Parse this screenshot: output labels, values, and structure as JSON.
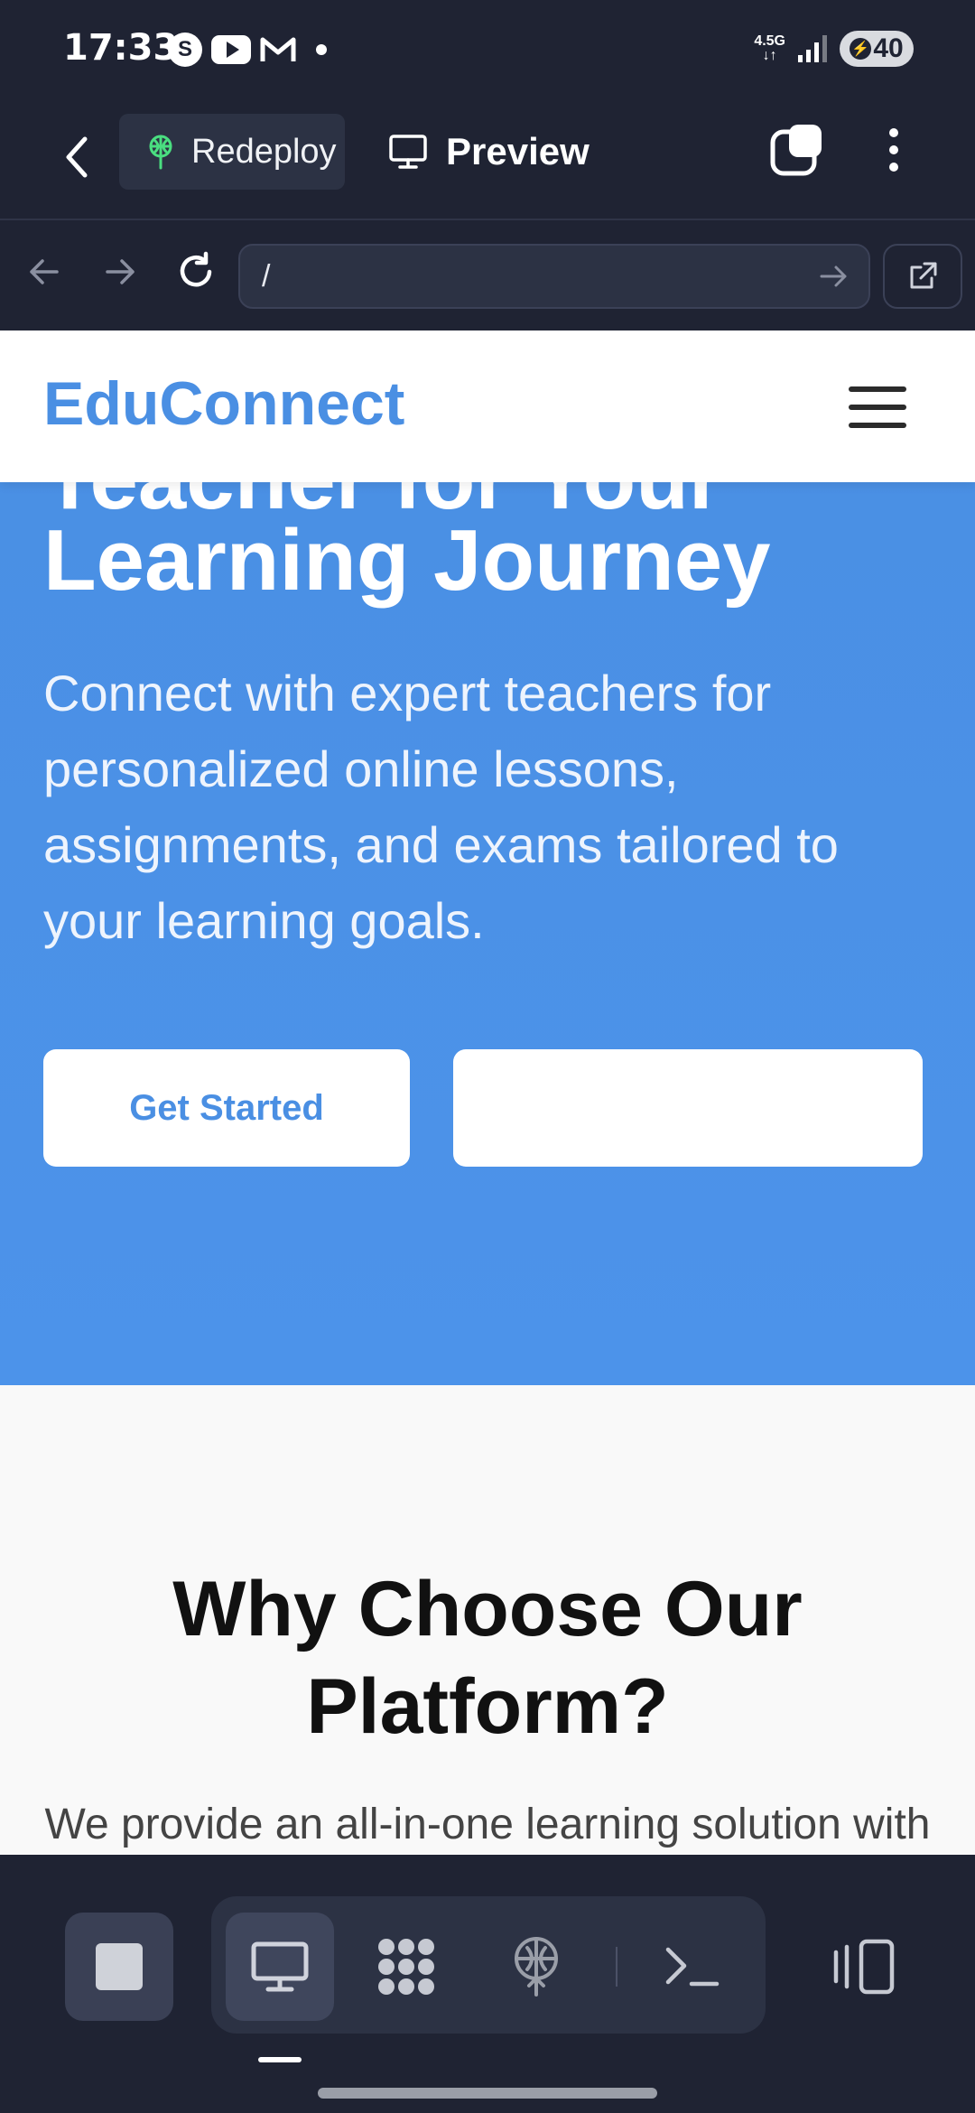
{
  "status_bar": {
    "time": "17:33",
    "network": "4.5G",
    "battery": "40",
    "notification_icons": [
      "s-app-icon",
      "youtube-icon",
      "gmail-icon"
    ]
  },
  "toolbar": {
    "redeploy_label": "Redeploy",
    "preview_label": "Preview"
  },
  "browser": {
    "url": "/"
  },
  "site": {
    "logo": "EduConnect",
    "hero_clipped_line": "Teacher for Your",
    "hero_title": "Learning Journey",
    "hero_subtitle": "Connect with expert teachers for personalized online lessons, assignments, and exams tailored to your learning goals.",
    "primary_button": "Get Started",
    "secondary_button": "",
    "section_title": "Why Choose Our Platform?",
    "section_subtitle": "We provide an all-in-one learning solution with"
  },
  "colors": {
    "app_background": "#1f2333",
    "brand_blue": "#4a8fe3",
    "hero_background": "#4c93ea",
    "redeploy_accent": "#4ade80"
  },
  "dock": {
    "items": [
      "stop-icon",
      "desktop-icon",
      "apps-grid-icon",
      "deploy-icon",
      "terminal-icon",
      "layout-toggle-icon"
    ]
  }
}
